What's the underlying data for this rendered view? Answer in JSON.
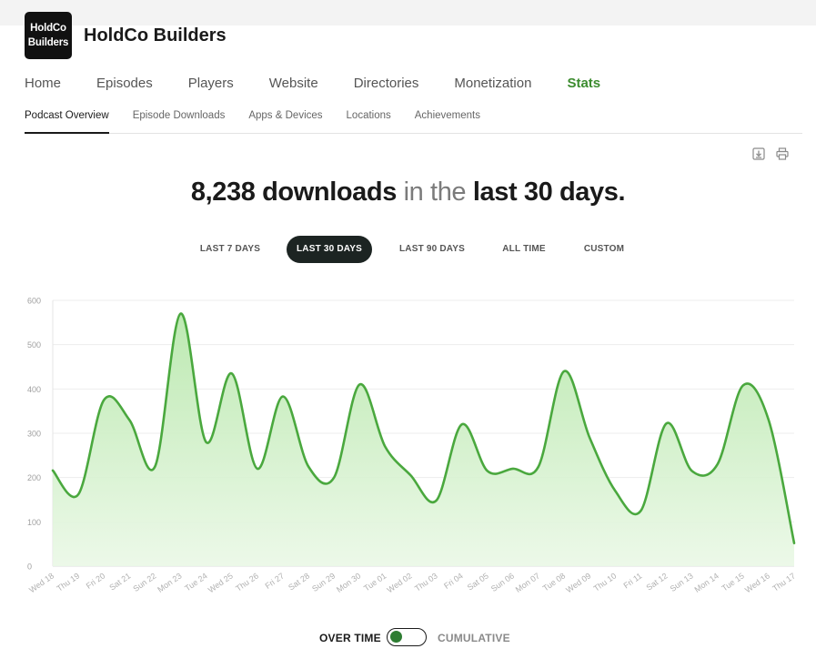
{
  "podcast": {
    "logo_line1": "HoldCo",
    "logo_line2": "Builders",
    "title": "HoldCo Builders"
  },
  "main_nav": [
    {
      "label": "Home"
    },
    {
      "label": "Episodes"
    },
    {
      "label": "Players"
    },
    {
      "label": "Website"
    },
    {
      "label": "Directories"
    },
    {
      "label": "Monetization"
    },
    {
      "label": "Stats",
      "active": true
    }
  ],
  "sub_nav": [
    {
      "label": "Podcast Overview",
      "active": true
    },
    {
      "label": "Episode Downloads"
    },
    {
      "label": "Apps & Devices"
    },
    {
      "label": "Locations"
    },
    {
      "label": "Achievements"
    }
  ],
  "tools": {
    "download_icon": "download-icon",
    "print_icon": "print-icon"
  },
  "headline": {
    "count": "8,238 downloads",
    "middle": "in the",
    "period": "last 30 days."
  },
  "ranges": [
    {
      "label": "LAST 7 DAYS"
    },
    {
      "label": "LAST 30 DAYS",
      "active": true
    },
    {
      "label": "LAST 90 DAYS"
    },
    {
      "label": "ALL TIME"
    },
    {
      "label": "CUSTOM"
    }
  ],
  "toggle": {
    "left_label": "OVER TIME",
    "right_label": "CUMULATIVE",
    "state": "over-time"
  },
  "colors": {
    "accent": "#3c8c2f",
    "line": "#4aa83e",
    "fill_top": "#b9e8ad",
    "fill_bottom": "#eaf8e6",
    "active_pill": "#1c2422"
  },
  "chart_data": {
    "type": "area",
    "ylim": [
      0,
      600
    ],
    "yticks": [
      "0",
      "100",
      "200",
      "300",
      "400",
      "500",
      "600"
    ],
    "grid": true,
    "categories": [
      "Wed 18",
      "Thu 19",
      "Fri 20",
      "Sat 21",
      "Sun 22",
      "Mon 23",
      "Tue 24",
      "Wed 25",
      "Thu 26",
      "Fri 27",
      "Sat 28",
      "Sun 29",
      "Mon 30",
      "Tue 01",
      "Wed 02",
      "Thu 03",
      "Fri 04",
      "Sat 05",
      "Sun 06",
      "Mon 07",
      "Tue 08",
      "Wed 09",
      "Thu 10",
      "Fri 11",
      "Sat 12",
      "Sun 13",
      "Mon 14",
      "Tue 15",
      "Wed 16",
      "Thu 17"
    ],
    "series": [
      {
        "values": [
          216,
          162,
          375,
          330,
          225,
          570,
          280,
          435,
          220,
          383,
          225,
          200,
          410,
          270,
          205,
          148,
          320,
          215,
          220,
          225,
          440,
          290,
          170,
          125,
          322,
          215,
          230,
          408,
          330,
          52
        ]
      }
    ]
  }
}
